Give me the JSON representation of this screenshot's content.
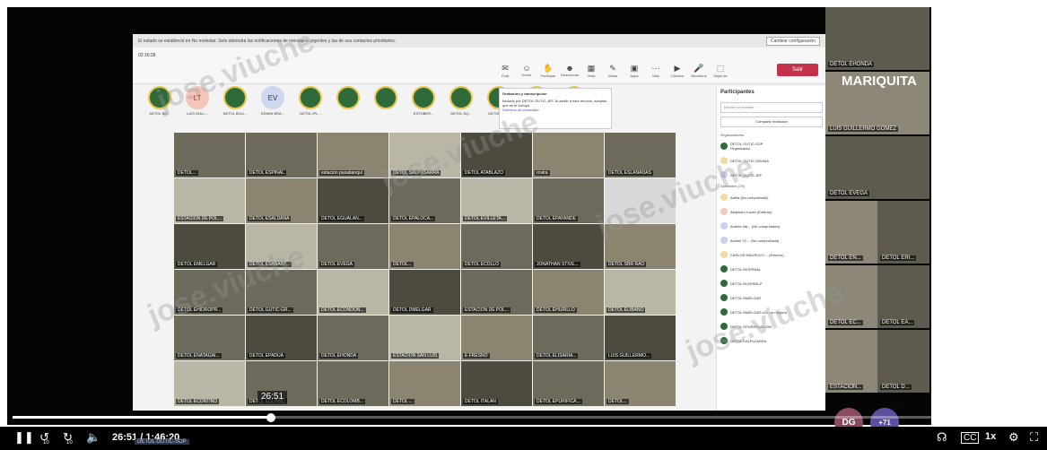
{
  "notification": {
    "text": "El estado se estableció en No molestar. Solo obtendrá las notificaciones de mensajes urgentes y las de sus contactos prioritarios.",
    "config_button": "Cambiar configuración"
  },
  "meeting": {
    "timer": "02:16:28",
    "toolbar": [
      "Chat",
      "Gente",
      "Participar",
      "Reaccionar",
      "Vista",
      "Notas",
      "Apps",
      "Más",
      "Cámara",
      "Micrófono",
      "Dejar de"
    ],
    "leave_label": "Salir",
    "avatars": [
      {
        "initials": "",
        "label": "DETOL BH..."
      },
      {
        "initials": "LT",
        "label": "LUIS GULL..."
      },
      {
        "initials": "",
        "label": "DETOL BOLI..."
      },
      {
        "initials": "EV",
        "label": "EDWIN BRA..."
      },
      {
        "initials": "",
        "label": "DETOL IPL..."
      },
      {
        "initials": "",
        "label": ""
      },
      {
        "initials": "",
        "label": ""
      },
      {
        "initials": "",
        "label": "ESTOBER..."
      },
      {
        "initials": "",
        "label": "DETOL SQ..."
      },
      {
        "initials": "",
        "label": "DETOL GU..."
      },
      {
        "initials": "",
        "label": "DETOL SE..."
      },
      {
        "initials": "",
        "label": "No se muestran"
      }
    ],
    "popup": {
      "title": "Grabación y transcripción",
      "body": "Iniciado por DETOL GUTIC-JEF. Al asistir a esta reunión, aceptas que se te incluya.",
      "link": "Directiva de privacidad"
    },
    "tiles": [
      "DETOL...",
      "DETOL ESPINAL",
      "estacion pasabanqui",
      "DETOL SALPUSARRA",
      "DETOL ATABLAZO",
      "rovira",
      "DETOL ESLANADAS",
      "ESTACION DE POL...",
      "DETOL ESALDANA",
      "DETOL EGUALAN...",
      "DETOL EPALOCA...",
      "DETOL EVILLETA...",
      "DETOL EPAYANDE",
      "",
      "DETOL EMELGAR",
      "DETOL ESANANT...",
      "DETOL EVEGA",
      "DETOL...",
      "DETOL ECOLLO",
      "JONATHAN STIVE...",
      "DETOL SBR RAO",
      "DETOL EHIDROPR...",
      "DETOL GUTIC-GR...",
      "DETOL ECONDON...",
      "DETOL DMELGAR",
      "ESTACION DE POL...",
      "DETOL EHURILLO",
      "DETOL ELIBANO",
      "DETOL ENATAGAI...",
      "DETOL EPADUA",
      "DETOL EHONDA",
      "ESTACION SAN LUIS",
      "E FRESNO",
      "DETOL ELISARIA...",
      "LUIS GUILLERMO...",
      "DETOL ECONTINO",
      "DETOL EGUAMO",
      "DETOL ECOLOMB...",
      "DETOL ...",
      "DETOL ITALAN",
      "DETOL EPURIFICA...",
      "DETOL..."
    ]
  },
  "participants": {
    "title": "Participantes",
    "search_placeholder": "Escribe un nombre",
    "share_label": "Compartir invitación",
    "organizers_label": "Organizadores",
    "organizers": [
      {
        "name": "DETOL GUTIC-SOP",
        "sub": "Organizador"
      },
      {
        "name": "DETOL GUTIC-GRUMA",
        "sub": ""
      },
      {
        "name": "DETOL GUTIC-JEF",
        "sub": ""
      }
    ],
    "attendees_label": "Asistentes (79)",
    "attendees": [
      "Adela (No comprobado)",
      "Alejandro López (Externo)",
      "Andrés Var... (No comprobado)",
      "Avenel YC... (No comprobado)",
      "CARLOS MAURICIO ... (Externo)",
      "DETOL DESPINAL",
      "DETOL DLERIDA-P",
      "DETOL DMELGAR",
      "DETOL DMELGAR-USO en espera",
      "DETOL DPURIFICACION",
      "DETOL EALPUJARRA"
    ]
  },
  "side_tiles": [
    "DETOL EHONDA",
    "MARIQUITA",
    "LUIS GUILLERMO GOMEZ",
    "DETOL EVEGA",
    "DETOL EN...",
    "DETOL ERI...",
    "DETOL EC...",
    "DETOL EA...",
    "ESTACION...",
    "DETOL D..."
  ],
  "ghost_avatars": {
    "dg_initials": "DG",
    "dg_label": "DETOL G...",
    "more": "+71"
  },
  "watermark": "jose.viuche",
  "player": {
    "preview_time": "26:51",
    "current_time": "26:51",
    "duration": "1:46:20",
    "progress_fraction": 0.2525,
    "speed": "1x",
    "rewind_label": "10",
    "forward_label": "10",
    "caption_badge": "DETOL GUTIC-SOP"
  }
}
